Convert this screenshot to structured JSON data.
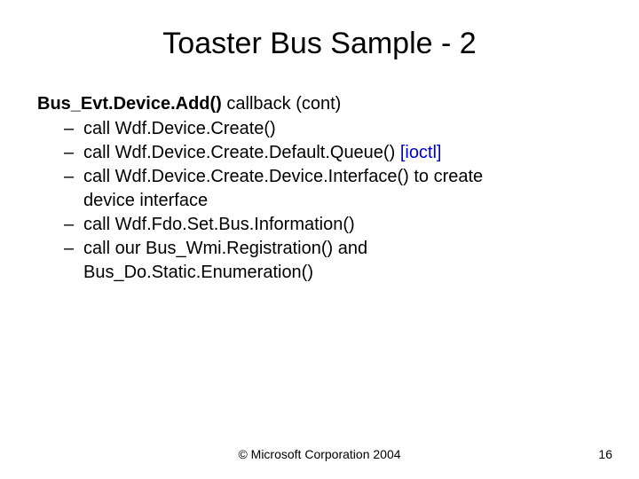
{
  "title": "Toaster Bus Sample - 2",
  "heading": {
    "bold": "Bus_Evt.Device.Add()",
    "normal": " callback (cont)"
  },
  "bullets": [
    {
      "text": "call Wdf.Device.Create()"
    },
    {
      "text": "call Wdf.Device.Create.Default.Queue() ",
      "annotation": "[ioctl]"
    },
    {
      "text": "call Wdf.Device.Create.Device.Interface() to create",
      "continuation": "device interface"
    },
    {
      "text": "call Wdf.Fdo.Set.Bus.Information()"
    },
    {
      "text": "call our Bus_Wmi.Registration() and",
      "continuation": "Bus_Do.Static.Enumeration()"
    }
  ],
  "footer": "© Microsoft Corporation 2004",
  "pageNumber": "16"
}
